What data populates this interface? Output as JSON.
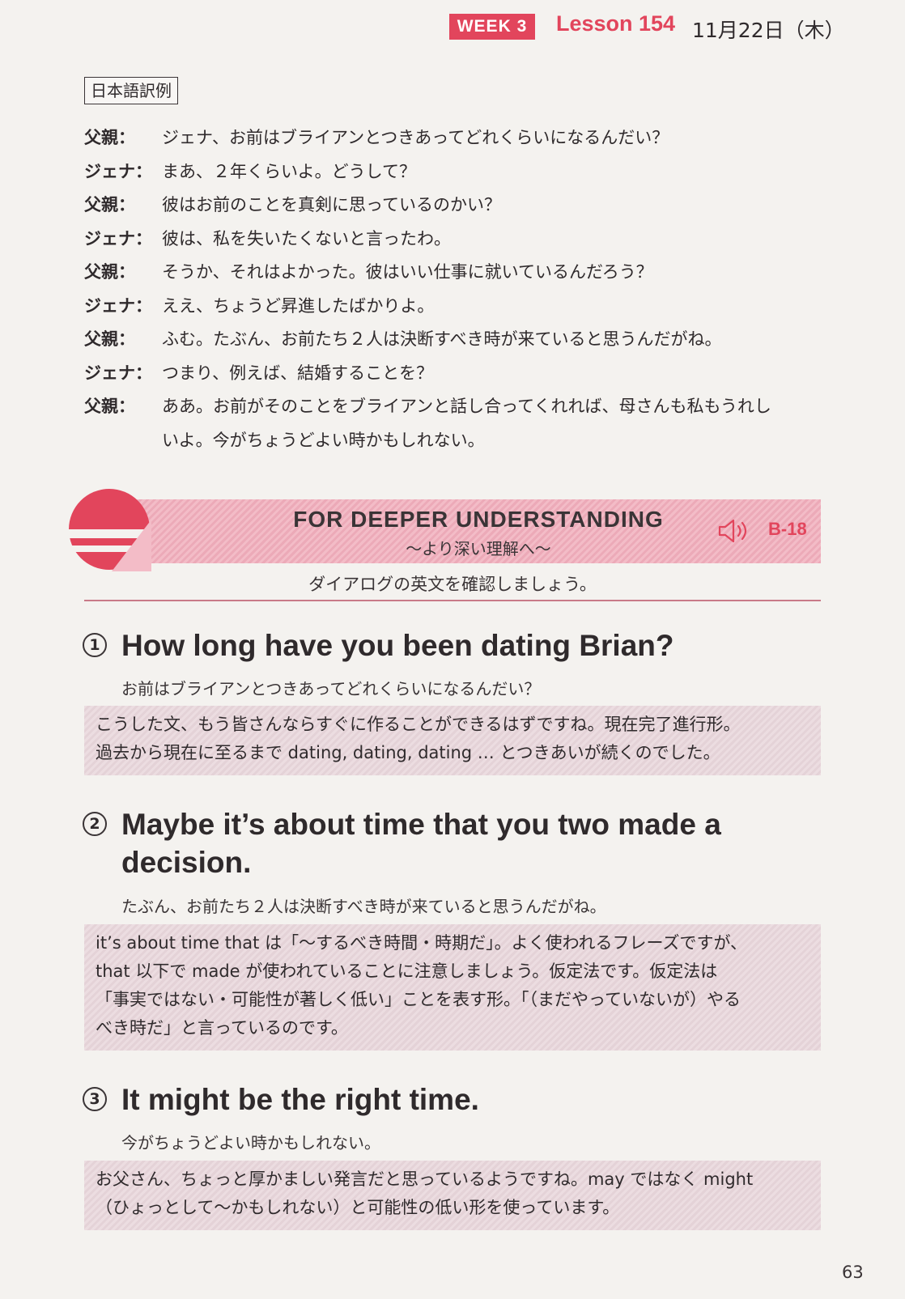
{
  "header": {
    "week_badge": "WEEK 3",
    "lesson": "Lesson 154",
    "date": "11月22日（木）"
  },
  "translation": {
    "label": "日本語訳例",
    "lines": [
      {
        "speaker": "父親：",
        "text": "ジェナ、お前はブライアンとつきあってどれくらいになるんだい？"
      },
      {
        "speaker": "ジェナ：",
        "text": "まあ、２年くらいよ。どうして？"
      },
      {
        "speaker": "父親：",
        "text": "彼はお前のことを真剣に思っているのかい？"
      },
      {
        "speaker": "ジェナ：",
        "text": "彼は、私を失いたくないと言ったわ。"
      },
      {
        "speaker": "父親：",
        "text": "そうか、それはよかった。彼はいい仕事に就いているんだろう？"
      },
      {
        "speaker": "ジェナ：",
        "text": "ええ、ちょうど昇進したばかりよ。"
      },
      {
        "speaker": "父親：",
        "text": "ふむ。たぶん、お前たち２人は決断すべき時が来ていると思うんだがね。"
      },
      {
        "speaker": "ジェナ：",
        "text": "つまり、例えば、結婚することを？"
      },
      {
        "speaker": "父親：",
        "text": "ああ。お前がそのことをブライアンと話し合ってくれれば、母さんも私もうれし"
      }
    ],
    "last_line_continuation": "いよ。今がちょうどよい時かもしれない。"
  },
  "banner": {
    "title": "FOR DEEPER UNDERSTANDING",
    "subtitle": "～より深い理解へ～",
    "track": "B-18",
    "instruction": "ダイアログの英文を確認しましょう。"
  },
  "points": [
    {
      "num": "1",
      "english": "How long have you been dating Brian?",
      "japanese": "お前はブライアンとつきあってどれくらいになるんだい？",
      "explanation": [
        "こうした文、もう皆さんならすぐに作ることができるはずですね。現在完了進行形。",
        "過去から現在に至るまで dating, dating, dating … とつきあいが続くのでした。"
      ]
    },
    {
      "num": "2",
      "english_line1": "Maybe it’s about time that you two made a",
      "english_line2": "decision.",
      "japanese": "たぶん、お前たち２人は決断すべき時が来ていると思うんだがね。",
      "explanation": [
        "it’s about time that は「～するべき時間・時期だ」。よく使われるフレーズですが、",
        "that 以下で made が使われていることに注意しましょう。仮定法です。仮定法は",
        "「事実ではない・可能性が著しく低い」ことを表す形。「（まだやっていないが）やる",
        "べき時だ」と言っているのです。"
      ]
    },
    {
      "num": "3",
      "english": "It might be the right time.",
      "japanese": "今がちょうどよい時かもしれない。",
      "explanation": [
        "お父さん、ちょっと厚かましい発言だと思っているようですね。may ではなく might",
        "（ひょっとして～かもしれない）と可能性の低い形を使っています。"
      ]
    }
  ],
  "page_number": "63",
  "colors": {
    "accent": "#e2455c",
    "banner_pink": "#f3bcc7",
    "explanation_bg": "#ecdde1"
  }
}
